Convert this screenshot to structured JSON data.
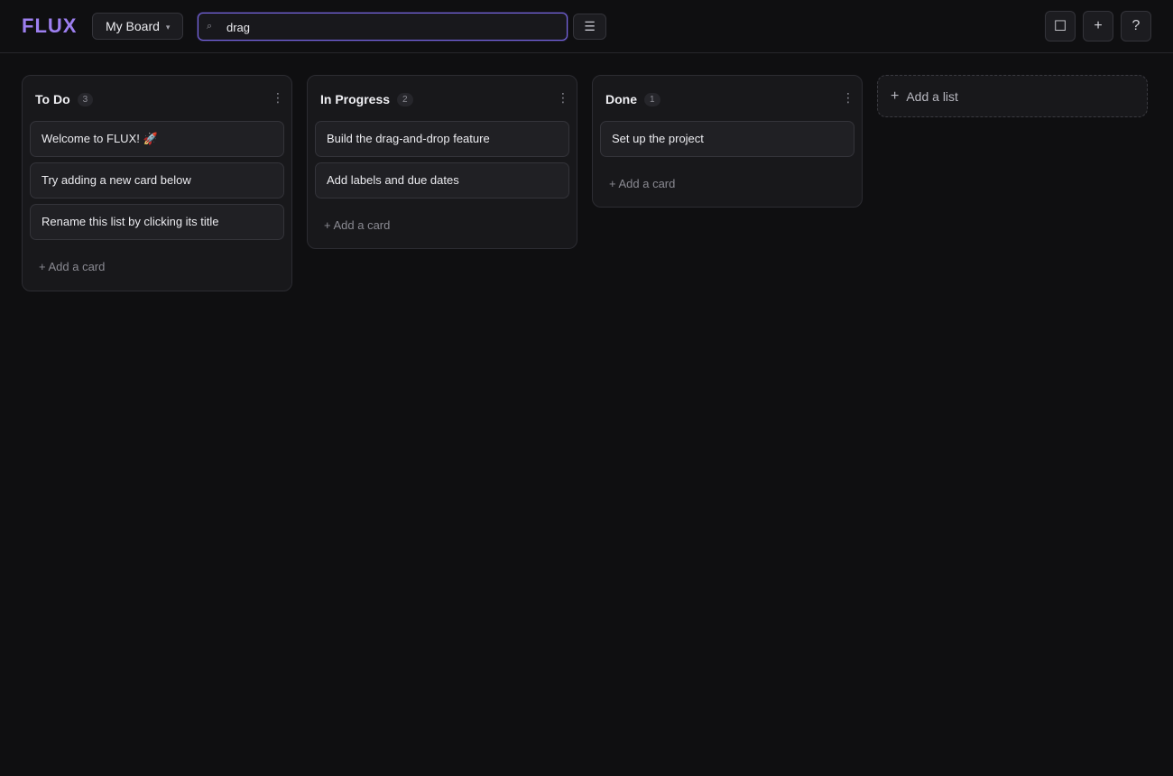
{
  "app": {
    "logo": "FLUX"
  },
  "header": {
    "board_name": "My Board",
    "board_chevron": "▾",
    "search": {
      "value": "drag",
      "icon": "search-icon",
      "icon_glyph": "⌕"
    },
    "filter_glyph": "☰",
    "actions": [
      {
        "name": "square-icon",
        "glyph": "☐"
      },
      {
        "name": "plus-icon",
        "glyph": "+"
      },
      {
        "name": "help-icon",
        "glyph": "?"
      }
    ]
  },
  "lists": [
    {
      "title": "To Do",
      "count": "3",
      "cards": [
        "Welcome to FLUX! 🚀",
        "Try adding a new card below",
        "Rename this list by clicking its title"
      ],
      "add_card": "+ Add a card"
    },
    {
      "title": "In Progress",
      "count": "2",
      "cards": [
        "Build the drag-and-drop feature",
        "Add labels and due dates"
      ],
      "add_card": "+ Add a card"
    },
    {
      "title": "Done",
      "count": "1",
      "cards": [
        "Set up the project"
      ],
      "add_card": "+ Add a card"
    }
  ],
  "list_menu_glyph": "⋮",
  "add_list": {
    "plus": "+",
    "label": "Add a list"
  },
  "colors": {
    "accent": "#9d7ff0",
    "background": "#0f0f11",
    "focus_border": "#7a68e8"
  }
}
